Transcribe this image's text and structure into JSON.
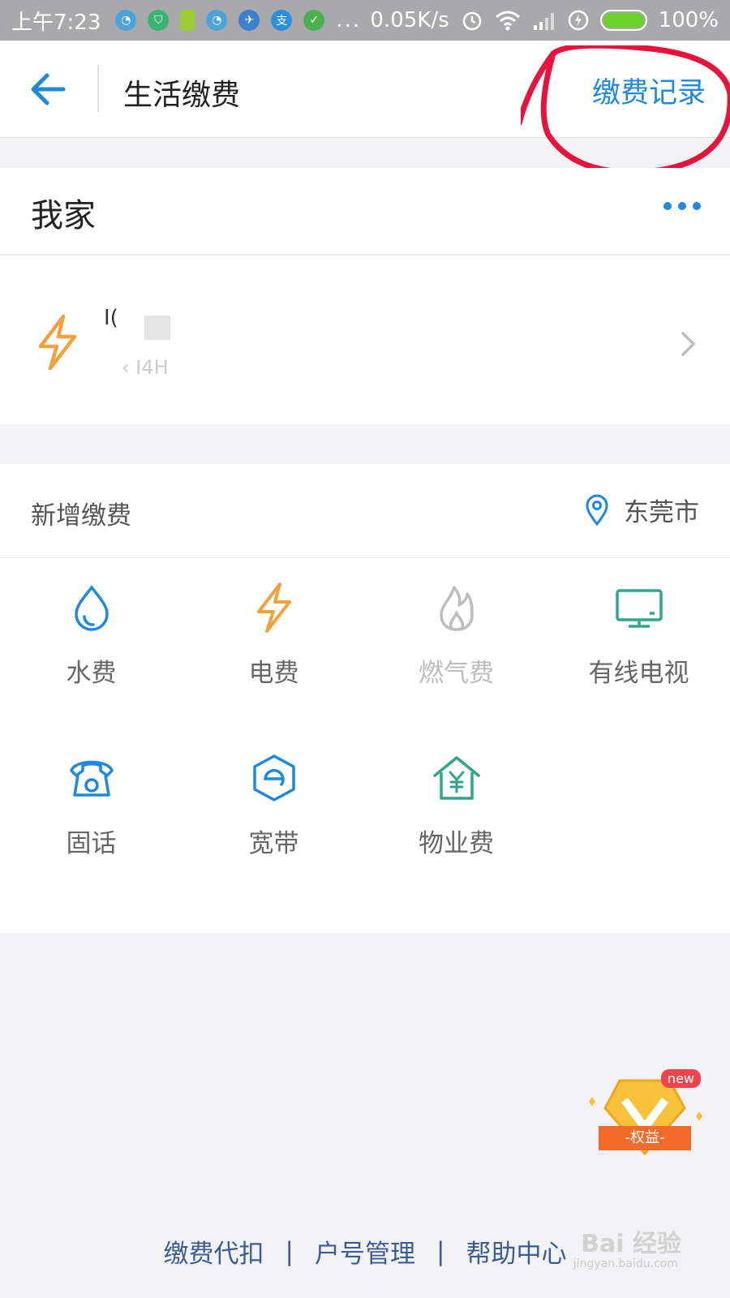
{
  "status_bar": {
    "time": "上午7:23",
    "app_icons": [
      "clock-app-icon",
      "shield-app-icon",
      "battery-app-icon",
      "clock-app-icon",
      "bird-app-icon",
      "alipay-app-icon",
      "check-app-icon"
    ],
    "more": "...",
    "speed": "0.05K/s",
    "battery": "100%"
  },
  "header": {
    "title": "生活缴费",
    "record_label": "缴费记录"
  },
  "home": {
    "title": "我家",
    "bill": {
      "name": "I(",
      "sub": "‹ I4H"
    }
  },
  "new_bill": {
    "title": "新增缴费",
    "city": "东莞市",
    "items": [
      {
        "label": "水费",
        "icon": "water-drop-icon"
      },
      {
        "label": "电费",
        "icon": "lightning-icon"
      },
      {
        "label": "燃气费",
        "icon": "flame-icon"
      },
      {
        "label": "有线电视",
        "icon": "tv-icon"
      },
      {
        "label": "固话",
        "icon": "telephone-icon"
      },
      {
        "label": "宽带",
        "icon": "broadband-icon"
      },
      {
        "label": "物业费",
        "icon": "property-house-icon"
      }
    ]
  },
  "badge": {
    "new_label": "new",
    "text": "-权益-"
  },
  "footer": {
    "link1": "缴费代扣",
    "link2": "户号管理",
    "link3": "帮助中心",
    "separator": "|"
  },
  "watermark": {
    "text": "Bai 经验",
    "sub": "jingyan.baidu.com"
  },
  "colors": {
    "accent": "#1f89e0",
    "electric": "#f0a23c",
    "teal": "#2fa58a",
    "status_bar": "#a9a9ab",
    "annotation": "#e8123a"
  }
}
